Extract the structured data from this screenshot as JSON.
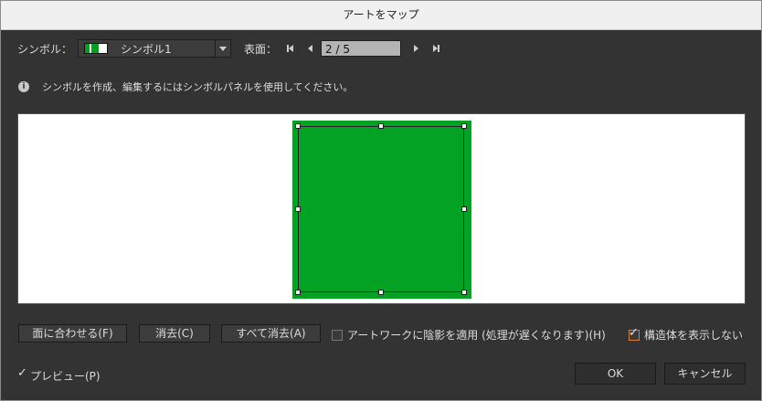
{
  "window": {
    "title": "アートをマップ"
  },
  "symbol": {
    "label": "シンボル：",
    "selected": "シンボル1",
    "swatch_colors": [
      "#00a020",
      "#ffffff"
    ]
  },
  "surface": {
    "label": "表面：",
    "value": "2 / 5"
  },
  "info": {
    "message": "シンボルを作成、編集するにはシンボルパネルを使用してください。"
  },
  "preview": {
    "art_color": "#04a224",
    "background": "#ffffff"
  },
  "buttons": {
    "fit_to_face": "面に合わせる(F)",
    "clear": "消去(C)",
    "clear_all": "すべて消去(A)",
    "ok": "OK",
    "cancel": "キャンセル"
  },
  "options": {
    "shade_artwork": {
      "label": "アートワークに陰影を適用 (処理が遅くなります)(H)",
      "checked": false
    },
    "invisible_geometry": {
      "label": "構造体を表示しない",
      "checked": true
    },
    "preview": {
      "label": "プレビュー(P)",
      "checked": true
    }
  }
}
